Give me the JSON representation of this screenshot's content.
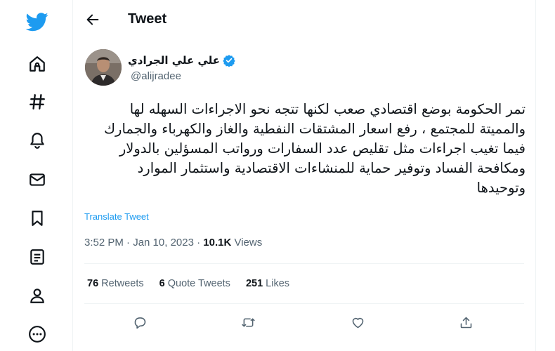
{
  "nav": {
    "items": [
      {
        "icon": "twitter-logo-icon"
      },
      {
        "icon": "home-icon"
      },
      {
        "icon": "explore-hashtag-icon"
      },
      {
        "icon": "notifications-bell-icon"
      },
      {
        "icon": "messages-envelope-icon"
      },
      {
        "icon": "bookmarks-icon"
      },
      {
        "icon": "lists-icon"
      },
      {
        "icon": "profile-icon"
      },
      {
        "icon": "more-icon"
      }
    ]
  },
  "header": {
    "title": "Tweet"
  },
  "tweet": {
    "author_name": "علي علي الجرادي",
    "author_handle": "@alijradee",
    "text_lines": [
      "تمر الحكومة بوضع اقتصادي صعب لكنها تتجه نحو الاجراءات السهله لها",
      "والمميتة للمجتمع ، رفع اسعار المشتقات النفطية والغاز والكهرباء والجمارك",
      "فيما تغيب اجراءات مثل تقليص عدد السفارات ورواتب المسؤلين بالدولار",
      "ومكافحة الفساد وتوفير حماية للمنشاءات الاقتصادية واستثمار الموارد",
      "وتوحيدها"
    ],
    "translate_label": "Translate Tweet",
    "time": "3:52 PM · Jan 10, 2023 · ",
    "views_count": "10.1K",
    "views_label": " Views"
  },
  "stats": {
    "retweets_count": "76",
    "retweets_label": " Retweets",
    "quotes_count": "6",
    "quotes_label": " Quote Tweets",
    "likes_count": "251",
    "likes_label": " Likes"
  },
  "colors": {
    "brand": "#1d9bf0",
    "text": "#0f1419",
    "secondary": "#536471"
  }
}
